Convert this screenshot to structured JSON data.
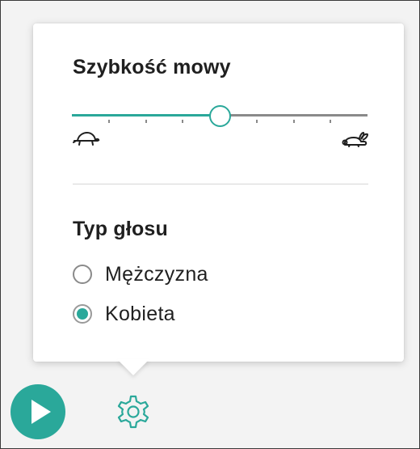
{
  "speed_section": {
    "title": "Szybkość mowy",
    "value_fraction": 0.5,
    "tick_count": 9,
    "slow_icon": "turtle-icon",
    "fast_icon": "rabbit-icon"
  },
  "voice_section": {
    "title": "Typ głosu",
    "options": [
      {
        "label": "Mężczyzna",
        "selected": false
      },
      {
        "label": "Kobieta",
        "selected": true
      }
    ]
  },
  "controls": {
    "play_icon": "play-icon",
    "settings_icon": "gear-icon"
  },
  "colors": {
    "accent": "#2aa89a",
    "track": "#8a8a8a",
    "text": "#1f1f1f"
  }
}
